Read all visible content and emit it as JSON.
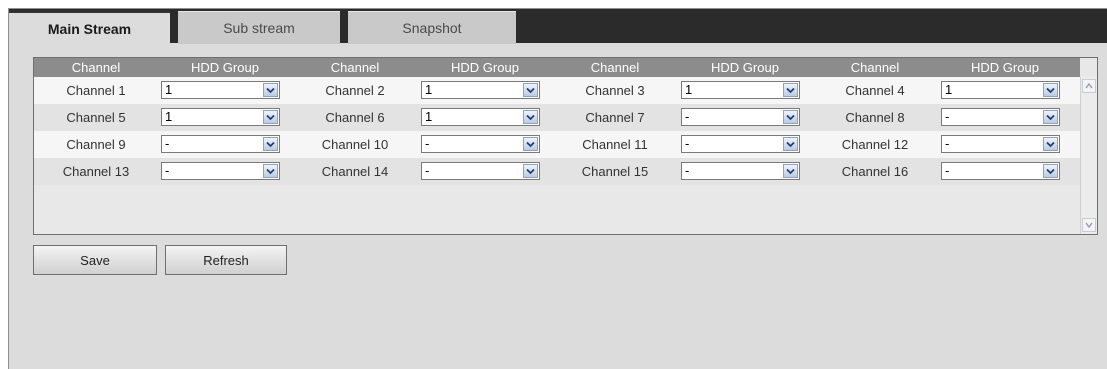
{
  "tabs": [
    {
      "label": "Main Stream",
      "active": true
    },
    {
      "label": "Sub stream",
      "active": false
    },
    {
      "label": "Snapshot",
      "active": false
    }
  ],
  "table": {
    "headers": [
      "Channel",
      "HDD Group",
      "Channel",
      "HDD Group",
      "Channel",
      "HDD Group",
      "Channel",
      "HDD Group"
    ],
    "rows": [
      [
        {
          "channel": "Channel 1",
          "group": "1"
        },
        {
          "channel": "Channel 2",
          "group": "1"
        },
        {
          "channel": "Channel 3",
          "group": "1"
        },
        {
          "channel": "Channel 4",
          "group": "1"
        }
      ],
      [
        {
          "channel": "Channel 5",
          "group": "1"
        },
        {
          "channel": "Channel 6",
          "group": "1"
        },
        {
          "channel": "Channel 7",
          "group": "-"
        },
        {
          "channel": "Channel 8",
          "group": "-"
        }
      ],
      [
        {
          "channel": "Channel 9",
          "group": "-"
        },
        {
          "channel": "Channel 10",
          "group": "-"
        },
        {
          "channel": "Channel 11",
          "group": "-"
        },
        {
          "channel": "Channel 12",
          "group": "-"
        }
      ],
      [
        {
          "channel": "Channel 13",
          "group": "-"
        },
        {
          "channel": "Channel 14",
          "group": "-"
        },
        {
          "channel": "Channel 15",
          "group": "-"
        },
        {
          "channel": "Channel 16",
          "group": "-"
        }
      ]
    ]
  },
  "buttons": {
    "save": "Save",
    "refresh": "Refresh"
  },
  "icons": {
    "dropdown": "chevron-down-icon",
    "scroll_up": "scroll-up-icon",
    "scroll_down": "scroll-down-icon"
  },
  "colors": {
    "tab_bar": "#2b2b2b",
    "header_bg": "#8c8c8c",
    "panel_bg": "#dcdcdc"
  }
}
